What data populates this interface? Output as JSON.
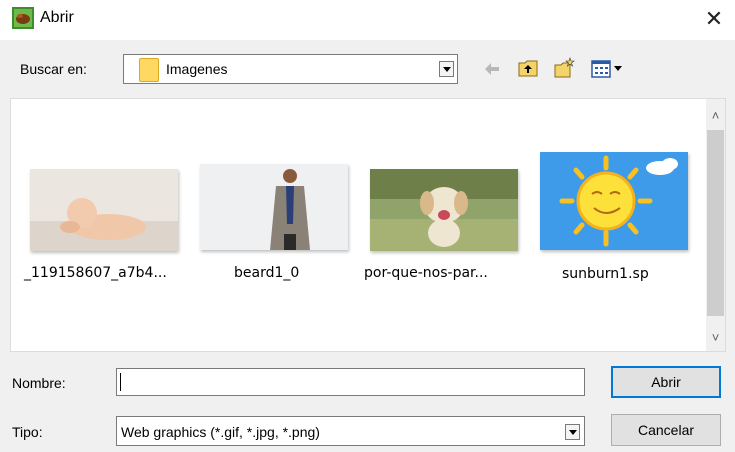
{
  "window": {
    "title": "Abrir",
    "close_label": "✕"
  },
  "lookin": {
    "label": "Buscar en:",
    "value": "Imagenes"
  },
  "toolbar": {
    "icons": [
      "back-arrow-icon",
      "up-folder-icon",
      "new-folder-icon",
      "view-menu-icon"
    ]
  },
  "files": [
    {
      "name": "_119158607_a7b4...",
      "thumb": "baby-photo"
    },
    {
      "name": "beard1_0",
      "thumb": "man-in-suit-photo"
    },
    {
      "name": "por-que-nos-par...",
      "thumb": "puppy-photo"
    },
    {
      "name": "sunburn1.sp",
      "thumb": "sun-cartoon"
    }
  ],
  "filename": {
    "label": "Nombre:",
    "value": ""
  },
  "filetype": {
    "label": "Tipo:",
    "value": "Web graphics (*.gif, *.jpg, *.png)"
  },
  "buttons": {
    "open": "Abrir",
    "cancel": "Cancelar"
  },
  "scroll": {
    "up": "˄",
    "down": "˅"
  },
  "colors": {
    "accent": "#0078d7",
    "folder": "#ffd861"
  }
}
